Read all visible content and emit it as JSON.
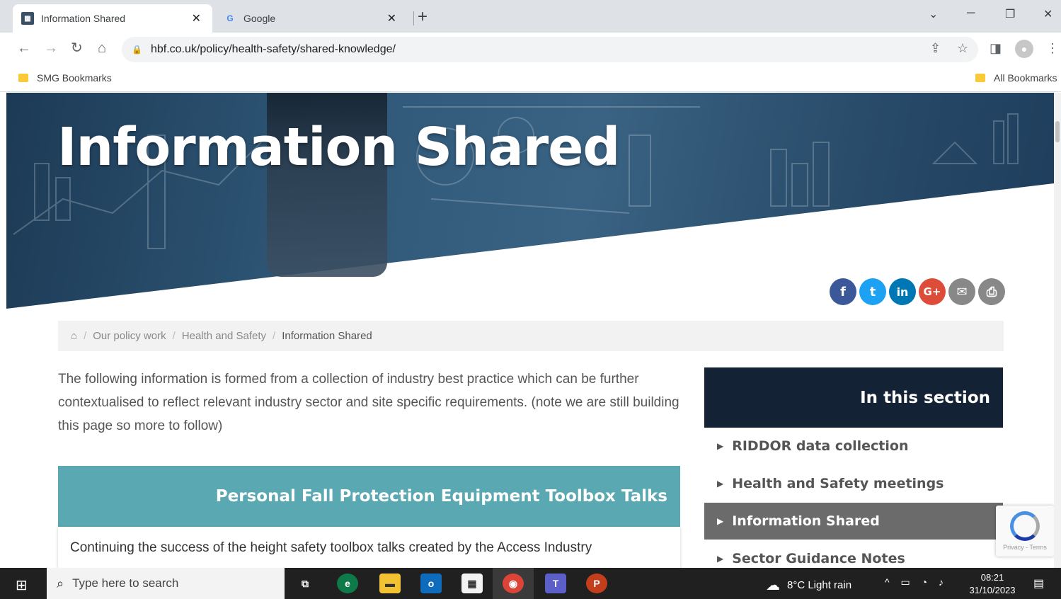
{
  "browser": {
    "tabs": [
      {
        "title": "Information Shared",
        "favicon": "hbf-icon",
        "active": true
      },
      {
        "title": "Google",
        "favicon": "google-icon",
        "active": false
      }
    ],
    "new_tab": "+",
    "url": "hbf.co.uk/policy/health-safety/shared-knowledge/",
    "bookmarks_left": "SMG Bookmarks",
    "bookmarks_right": "All Bookmarks"
  },
  "hero": {
    "title": "Information Shared"
  },
  "share_buttons": [
    {
      "name": "facebook",
      "glyph": "f",
      "color": "#3b5998"
    },
    {
      "name": "twitter",
      "glyph": "t",
      "color": "#1da1f2"
    },
    {
      "name": "linkedin",
      "glyph": "in",
      "color": "#0077b5"
    },
    {
      "name": "google-plus",
      "glyph": "G+",
      "color": "#dd4b39"
    },
    {
      "name": "email",
      "glyph": "✉",
      "color": "#888888"
    },
    {
      "name": "print",
      "glyph": "⎙",
      "color": "#888888"
    }
  ],
  "breadcrumb": {
    "home_icon": "home-icon",
    "items": [
      "Our policy work",
      "Health and Safety"
    ],
    "current": "Information Shared"
  },
  "intro": "The following information is formed from a collection of industry best practice which can be further contextualised to reflect relevant industry sector and site specific requirements. (note we are still building this page so more to follow)",
  "card": {
    "title": "Personal Fall Protection Equipment Toolbox Talks",
    "body": "Continuing the success of the height safety toolbox talks created by the Access Industry"
  },
  "sidebar": {
    "heading": "In this section",
    "items": [
      {
        "label": "RIDDOR data collection",
        "active": false
      },
      {
        "label": "Health and Safety meetings",
        "active": false
      },
      {
        "label": "Information Shared",
        "active": true
      },
      {
        "label": "Sector Guidance Notes",
        "active": false
      }
    ]
  },
  "recaptcha": {
    "text": "Privacy - Terms"
  },
  "taskbar": {
    "search_placeholder": "Type here to search",
    "weather": "8°C  Light rain",
    "time": "08:21",
    "date": "31/10/2023"
  }
}
